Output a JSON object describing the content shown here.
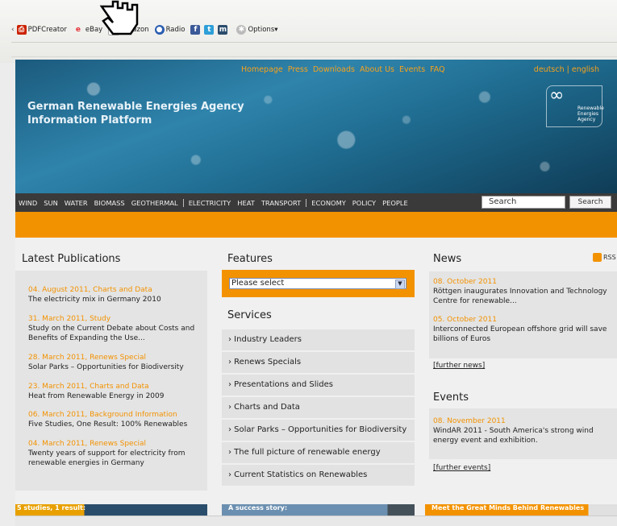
{
  "toolbar": {
    "items": [
      {
        "label": "PDFCreator",
        "icon": "pdf-icon",
        "color": "#cc2200"
      },
      {
        "label": "eBay",
        "icon": "ebay-icon",
        "color": "#e53238"
      },
      {
        "label": "Amazon",
        "icon": "amazon-icon",
        "color": "#222222"
      },
      {
        "label": "Radio",
        "icon": "radio-icon",
        "color": "#2a5db0"
      }
    ],
    "social_icons": [
      "facebook-icon",
      "twitter-icon",
      "myspace-icon"
    ],
    "options_label": "Options"
  },
  "header": {
    "nav": [
      "Homepage",
      "Press",
      "Downloads",
      "About Us",
      "Events",
      "FAQ"
    ],
    "lang": "deutsch | english",
    "title_line1": "German Renewable Energies Agency",
    "title_line2": "Information Platform",
    "logo_text": [
      "Renewable",
      "Energies",
      "Agency"
    ]
  },
  "mainnav": {
    "group1": [
      "WIND",
      "SUN",
      "WATER",
      "BIOMASS",
      "GEOTHERMAL"
    ],
    "group2": [
      "ELECTRICITY",
      "HEAT",
      "TRANSPORT"
    ],
    "group3": [
      "ECONOMY",
      "POLICY",
      "PEOPLE"
    ],
    "search_placeholder": "Search",
    "search_button": "Search"
  },
  "publications": {
    "heading": "Latest Publications",
    "items": [
      {
        "date": "04. August 2011, Charts and Data",
        "text": "The electricity mix in Germany 2010"
      },
      {
        "date": "31. March 2011, Study",
        "text": "Study on the Current Debate about Costs and Benefits of Expanding the Use..."
      },
      {
        "date": "28. March 2011, Renews Special",
        "text": "Solar Parks – Opportunities for Biodiversity"
      },
      {
        "date": "23. March 2011, Charts and Data",
        "text": "Heat from Renewable Energy in 2009"
      },
      {
        "date": "06. March 2011, Background Information",
        "text": "Five Studies, One Result: 100% Renewables"
      },
      {
        "date": "04. March 2011, Renews Special",
        "text": "Twenty years of support for electricity from renewable energies in Germany"
      }
    ]
  },
  "features": {
    "heading": "Features",
    "select_value": "Please select",
    "services_heading": "Services",
    "services": [
      "› Industry Leaders",
      "› Renews Specials",
      "› Presentations and Slides",
      "› Charts and Data",
      "› Solar Parks – Opportunities for Biodiversity",
      "› The full picture of renewable energy",
      "› Current Statistics on Renewables"
    ]
  },
  "news": {
    "heading": "News",
    "rss": "RSS",
    "items": [
      {
        "date": "08. October 2011",
        "text": "Röttgen inaugurates Innovation and Technology Centre for renewable..."
      },
      {
        "date": "05. October 2011",
        "text": "Interconnected European offshore grid will save billions of Euros"
      }
    ],
    "further": "[further news]"
  },
  "events": {
    "heading": "Events",
    "items": [
      {
        "date": "08. November 2011",
        "text": "WindAR 2011 - South America's strong wind energy event and exhibition."
      }
    ],
    "further": "[further events]"
  },
  "teasers": [
    "5 studies, 1 result:",
    "A success story:",
    "Meet the Great Minds Behind Renewables"
  ]
}
